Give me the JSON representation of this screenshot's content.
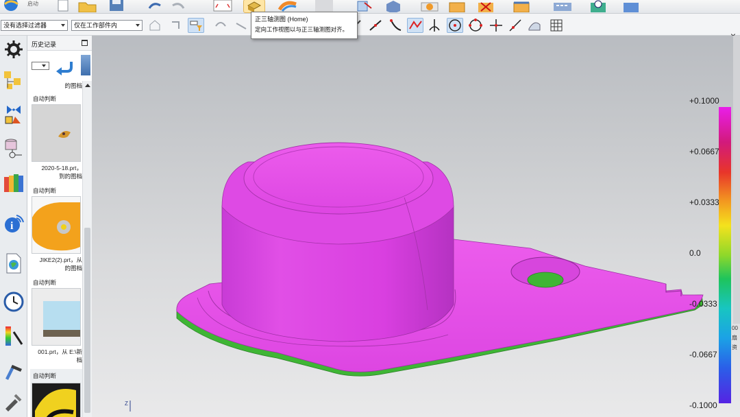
{
  "ribbon": {
    "start_label": "启动",
    "tabs_hint": ""
  },
  "toolbar": {
    "selection_filter": "没有选择过滤器",
    "selection_scope": "仅在工作部件内"
  },
  "tooltip": {
    "title": "正三轴测图 (Home)",
    "description": "定向工作视图以与正三轴测图对齐。"
  },
  "history": {
    "title": "历史记录",
    "top_caption": "的图档",
    "entries": [
      {
        "group": "自动判断",
        "caption_line1": "2020-5-18.prt，",
        "caption_line2": "到的图档"
      },
      {
        "group": "自动判断",
        "caption_line1": "JIKE2(2).prt，从",
        "caption_line2": "的图档"
      },
      {
        "group": "自动判断",
        "caption_line1": "001.prt，从 E:\\新",
        "caption_line2": "档"
      },
      {
        "group": "自动判断",
        "caption_line1": "",
        "caption_line2": ""
      }
    ]
  },
  "legend": {
    "title": "",
    "values": [
      "+0.1000",
      "+0.0667",
      "+0.0333",
      "0.0",
      "-0.0333",
      "-0.0667",
      "-0.1000"
    ],
    "colors": {
      "max": "#e91ee9",
      "zero": "#1ec45c",
      "min": "#5523e3"
    }
  },
  "side_note": {
    "line1": "00",
    "line2": "扇",
    "line3": "资"
  },
  "viewport": {
    "axis_label": "Z",
    "model_colors": {
      "top": "#e542e3",
      "side": "#3fb535"
    }
  }
}
